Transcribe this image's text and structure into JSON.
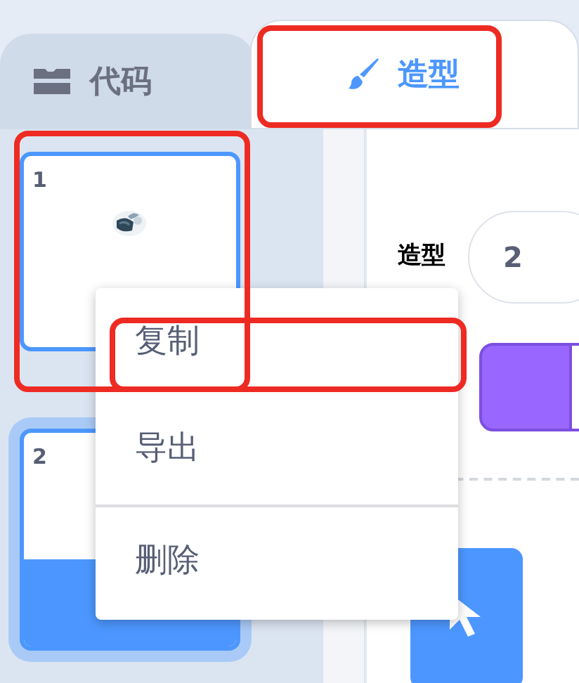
{
  "tabs": [
    {
      "label": "代码",
      "selected": false
    },
    {
      "label": "造型",
      "selected": true
    }
  ],
  "costumes": [
    {
      "number": "1",
      "selected": false,
      "hovered": true
    },
    {
      "number": "2",
      "selected": true,
      "hovered": false
    }
  ],
  "costume_name": {
    "label": "造型",
    "value": "2"
  },
  "context_menu": {
    "items": [
      "复制",
      "导出",
      "删除"
    ]
  }
}
